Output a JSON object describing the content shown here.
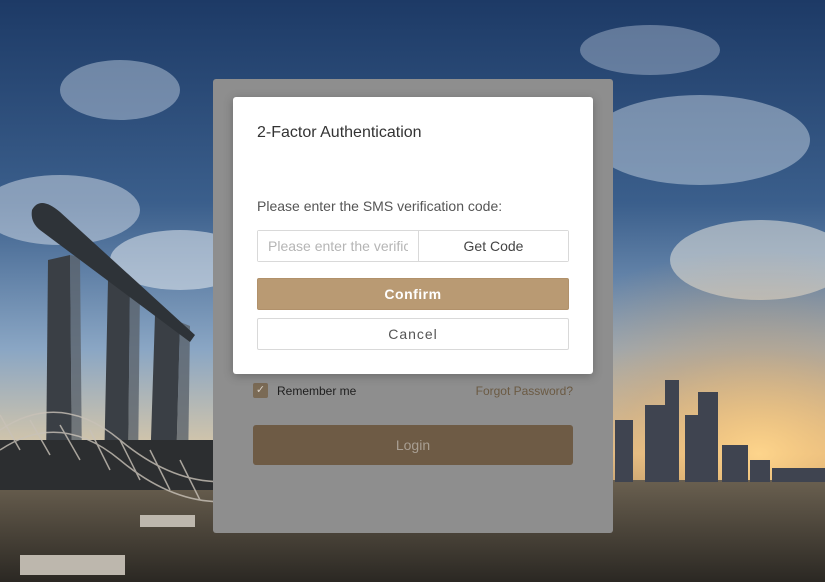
{
  "modal": {
    "title": "2-Factor Authentication",
    "prompt": "Please enter the SMS verification code:",
    "code_placeholder": "Please enter the verification code",
    "code_value": "",
    "get_code_label": "Get Code",
    "confirm_label": "Confirm",
    "cancel_label": "Cancel"
  },
  "login": {
    "remember_label": "Remember me",
    "remember_checked": true,
    "forgot_label": "Forgot Password?",
    "login_label": "Login"
  },
  "colors": {
    "accent": "#b99a73",
    "accent_dimmed": "#6e5b45",
    "card_dimmed": "#8e8e8e"
  },
  "icons": {
    "checkbox": "check-icon"
  }
}
